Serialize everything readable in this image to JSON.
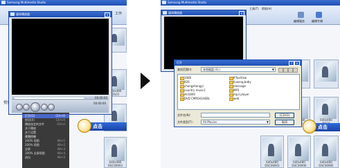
{
  "left": {
    "app_title": "Samsung Multimedia Studio",
    "player_title": "媒体播放器",
    "side_labels": [
      "工作",
      "预览"
    ],
    "time_display": "00:00:00",
    "time_total": "00:00:00",
    "context_menu": [
      {
        "label": "打开(O)",
        "shortcut": "Ctrl+O",
        "selected": true
      },
      {
        "label": "剪切(X)",
        "shortcut": "Ctrl+X"
      },
      {
        "label": "播放选定的文件",
        "shortcut": "Ctrl+I"
      },
      {
        "label": "关于播放",
        "shortcut": ""
      },
      {
        "label": "关于设置",
        "shortcut": ""
      },
      {
        "label": "视频控制",
        "shortcut": ""
      },
      {
        "label": "100% 视图",
        "shortcut": "Alt+1"
      },
      {
        "label": "200% 视图",
        "shortcut": "Alt+2"
      },
      {
        "label": "全屏",
        "shortcut": "Alt+3"
      },
      {
        "label": "100% 全屏视图",
        "shortcut": "Alt+4"
      },
      {
        "label": "退出",
        "shortcut": "Alt+5"
      }
    ],
    "thumbs": [
      {
        "caption": "640x480\nDSC0"
      },
      {
        "caption": "640x480\nDSC0"
      },
      {
        "caption": "640x480\nDSC0"
      },
      {
        "caption": "640x480\nDSC06903"
      }
    ],
    "callout": "点击"
  },
  "right": {
    "app_title": "Samsung Multimedia Studio",
    "player_title": "媒体播放器",
    "menu_strip": [
      "工具(T)",
      "帮助(H)"
    ],
    "toolbar": [
      "编辑服务",
      "编辑专辑"
    ],
    "dialog": {
      "title": "打开",
      "lookin_label": "查找范围(I):",
      "lookin_value": "本地磁盘 (G:)",
      "folders_col1": [
        "1080",
        "926",
        "chengzhangyi",
        "country music1",
        "dsi1800",
        "DVD CMR041AEBL"
      ],
      "folders_col2": [
        "IFfaxView",
        "liuxeng,baby",
        "message",
        "MP3",
        "mp3 player",
        "web"
      ],
      "filename_label": "文件名(N):",
      "filename_value": "",
      "filetype_label": "文件类型(T):",
      "filetype_value": "All Movies",
      "open_button": "打开(O)",
      "cancel_button": "取消"
    },
    "thumbs": [
      {
        "caption": "640x480\nDSC0"
      },
      {
        "caption": "640x480\nDSC0"
      },
      {
        "caption": "640x480\nDSC0"
      },
      {
        "caption": "640x480\nDSC06903"
      },
      {
        "caption": "640x480\nDSC06906"
      },
      {
        "caption": "640x480\nDSC06985"
      }
    ],
    "callout": "点击"
  }
}
